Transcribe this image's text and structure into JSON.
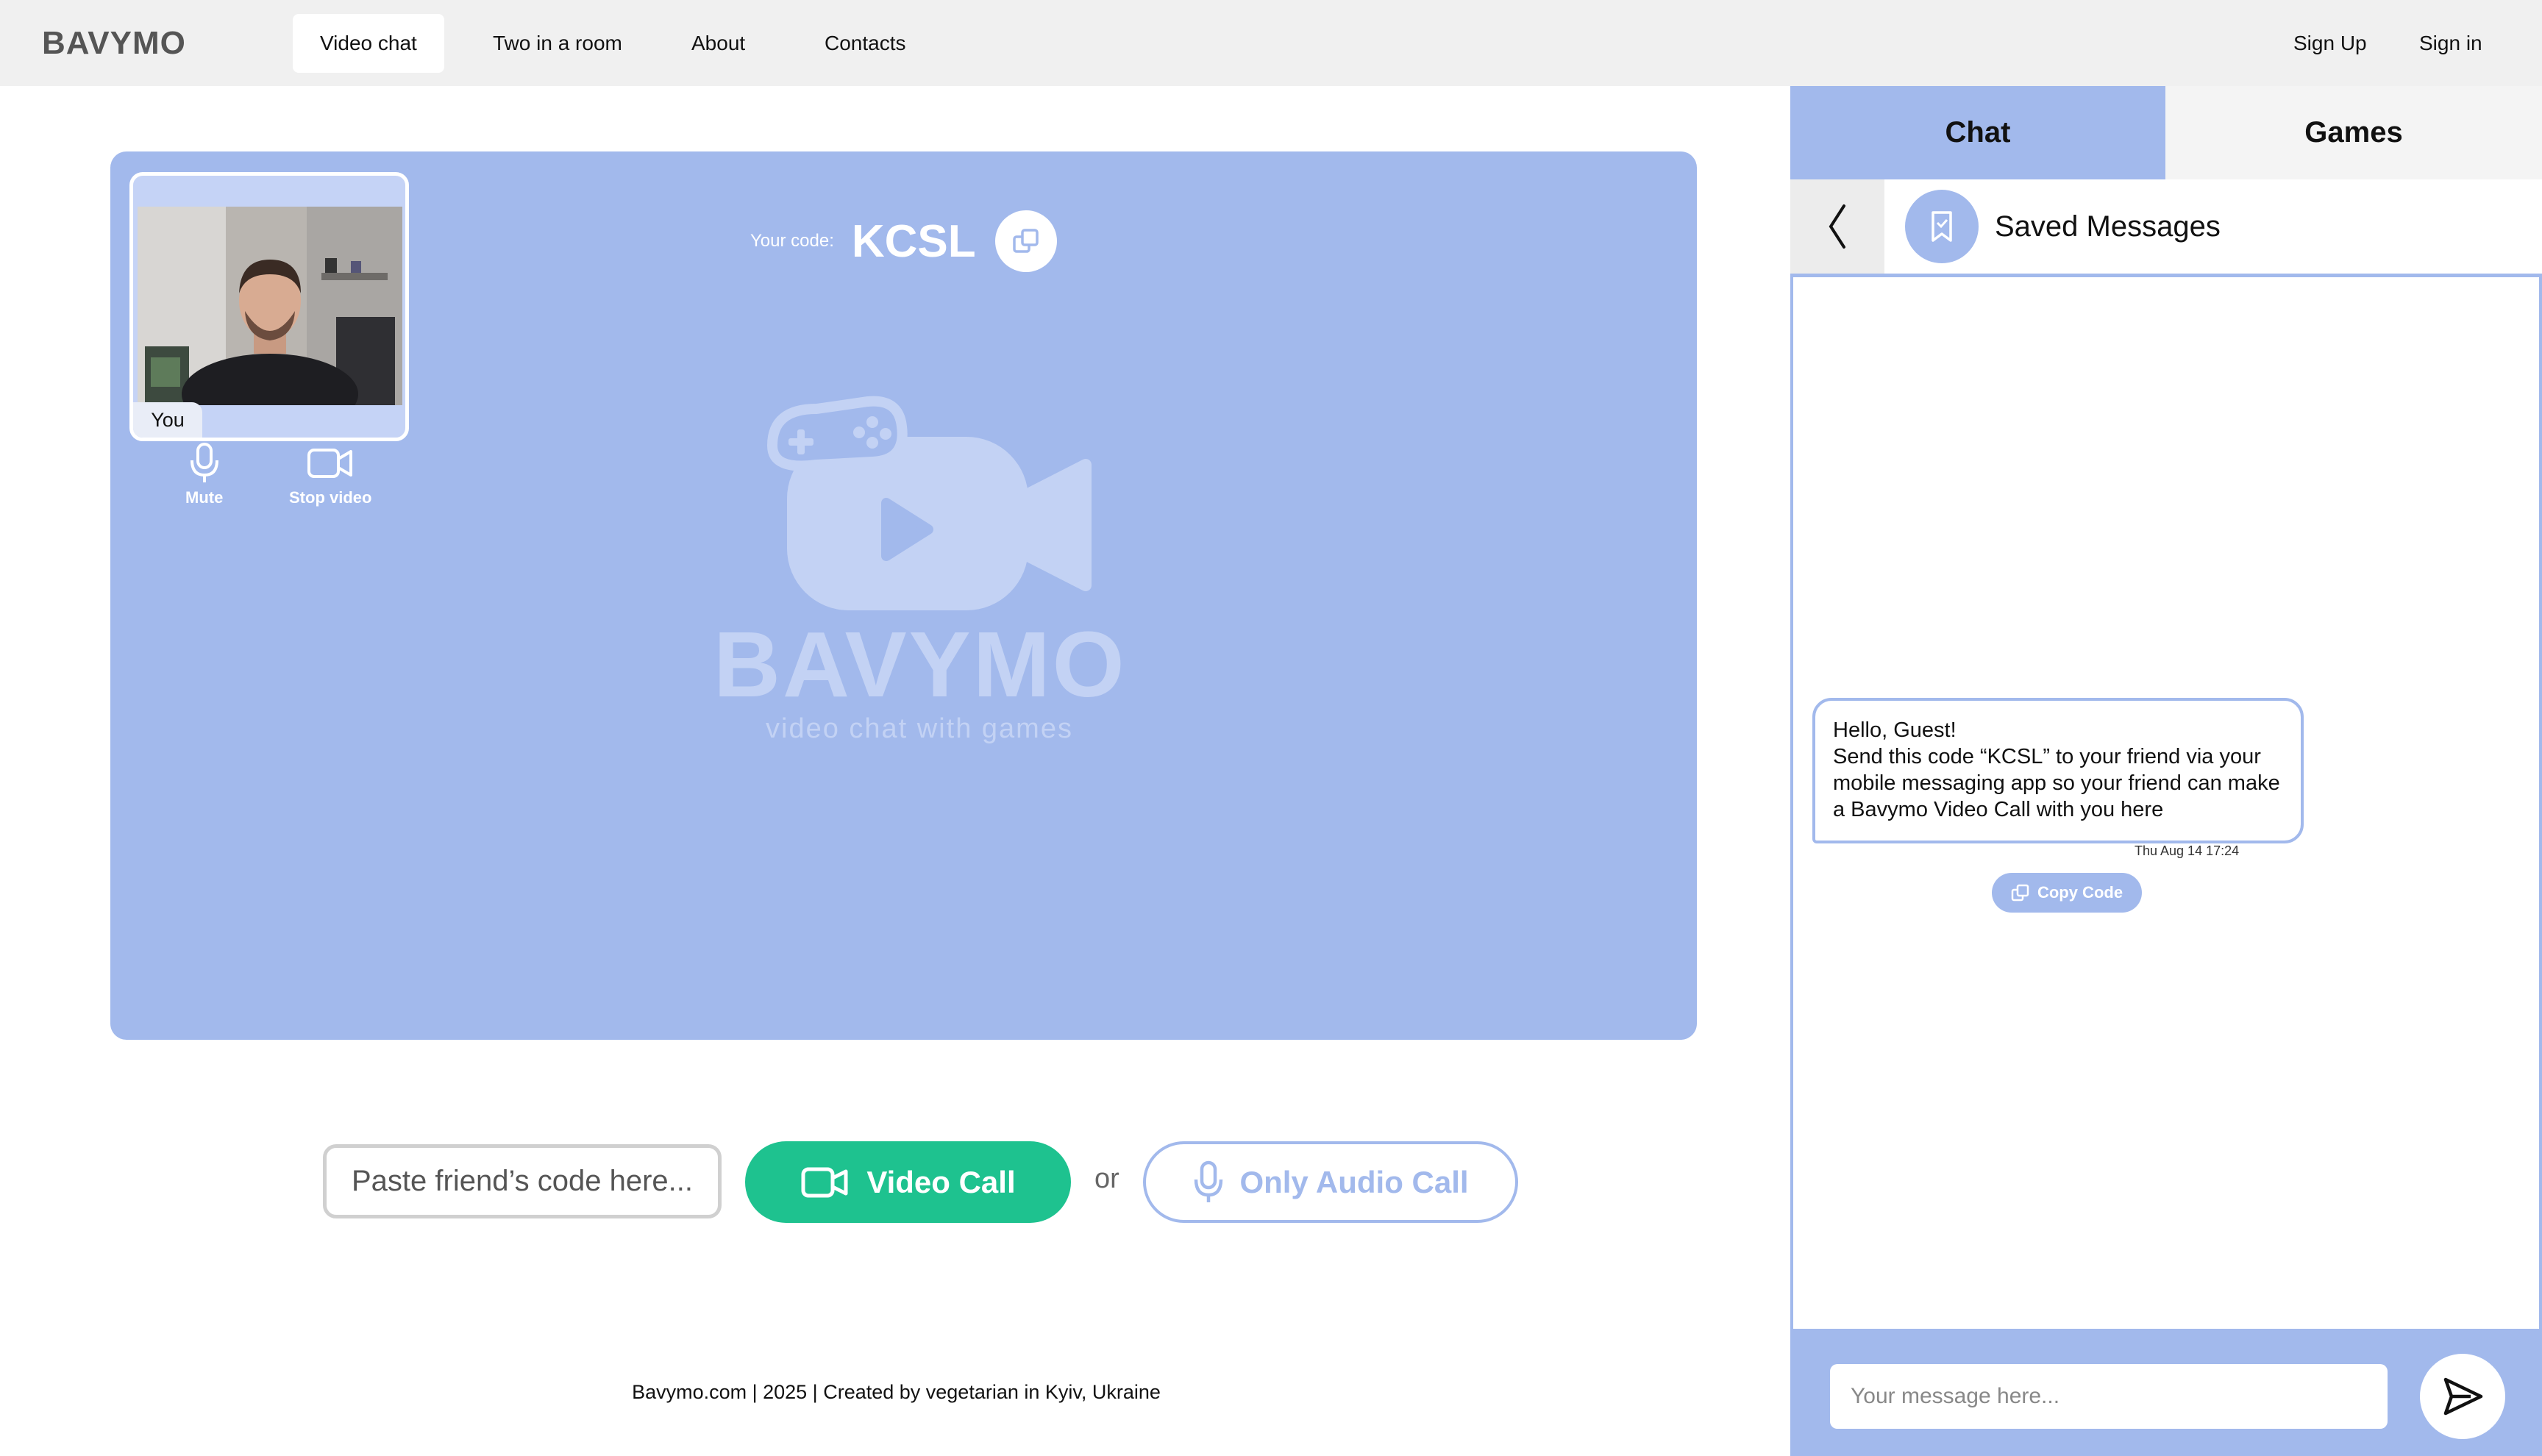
{
  "header": {
    "logo": "BAVYMO",
    "nav": [
      {
        "label": "Video chat",
        "active": true
      },
      {
        "label": "Two in a room"
      },
      {
        "label": "About"
      },
      {
        "label": "Contacts"
      }
    ],
    "sign_up": "Sign Up",
    "sign_in": "Sign in"
  },
  "stage": {
    "self_label": "You",
    "mute_label": "Mute",
    "stop_video_label": "Stop video",
    "code_label": "Your code:",
    "code_value": "KCSL",
    "watermark_title": "BAVYMO",
    "watermark_subtitle": "video chat with games"
  },
  "call_bar": {
    "input_placeholder": "Paste friend’s code here...",
    "video_call_label": "Video Call",
    "or_label": "or",
    "audio_call_label": "Only Audio Call"
  },
  "footer": {
    "text": "Bavymo.com | 2025 | Created by vegetarian in Kyiv, Ukraine"
  },
  "panel": {
    "tabs": [
      {
        "label": "Chat",
        "active": true
      },
      {
        "label": "Games"
      }
    ],
    "chat_title": "Saved Messages",
    "message": {
      "line1": "Hello, Guest!",
      "line2": "Send this code “KCSL” to your friend via your mobile messaging app so your friend can make a Bavymo Video Call with you here",
      "time": "Thu Aug 14  17:24"
    },
    "copy_code_label": "Copy Code",
    "input_placeholder": "Your message here..."
  },
  "colors": {
    "accent": "#a2b9ec",
    "green": "#1ec28f",
    "header_bg": "#f0f0f0"
  },
  "icons": [
    "mic-icon",
    "video-camera-icon",
    "copy-icon",
    "back-chevron-icon",
    "bookmark-icon",
    "send-icon",
    "gamepad-camera-logo"
  ]
}
